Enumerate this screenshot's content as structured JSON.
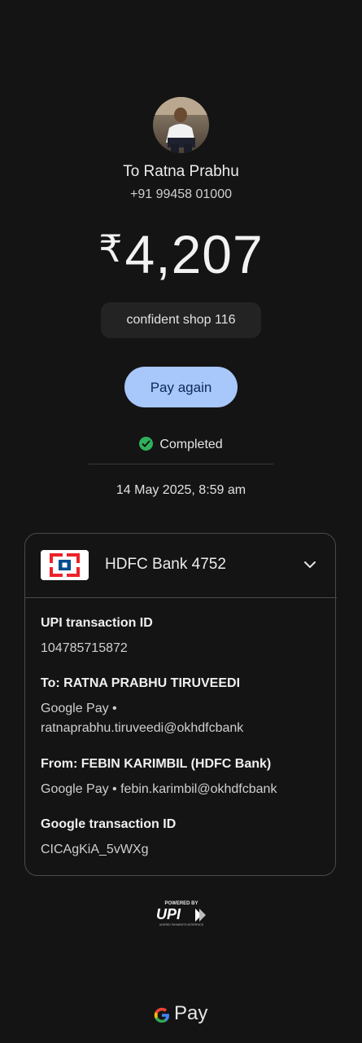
{
  "recipient": {
    "name": "To Ratna Prabhu",
    "phone": "+91 99458 01000"
  },
  "amount": {
    "currency_symbol": "₹",
    "value": "4,207"
  },
  "note": "confident shop 116",
  "actions": {
    "pay_again_label": "Pay again"
  },
  "status": {
    "label": "Completed",
    "color": "#2fb15b"
  },
  "date": "14 May 2025, 8:59 am",
  "bank": {
    "name": "HDFC Bank 4752",
    "logo_icon": "hdfc-bank-logo"
  },
  "details": [
    {
      "label": "UPI transaction ID",
      "value": "104785715872"
    },
    {
      "label": "To: RATNA PRABHU TIRUVEEDI",
      "value": "Google Pay •\nratnaprabhu.tiruveedi@okhdfcbank"
    },
    {
      "label": "From: FEBIN KARIMBIL (HDFC Bank)",
      "value": "Google Pay • febin.karimbil@okhdfcbank"
    },
    {
      "label": "Google transaction ID",
      "value": "CICAgKiA_5vWXg"
    }
  ],
  "footer": {
    "powered_by": "POWERED BY",
    "upi_text": "UPI",
    "upi_tagline": "UNIFIED PAYMENTS INTERFACE",
    "gpay_text": "Pay"
  },
  "colors": {
    "background": "#141414",
    "accent": "#a8c7fa"
  }
}
